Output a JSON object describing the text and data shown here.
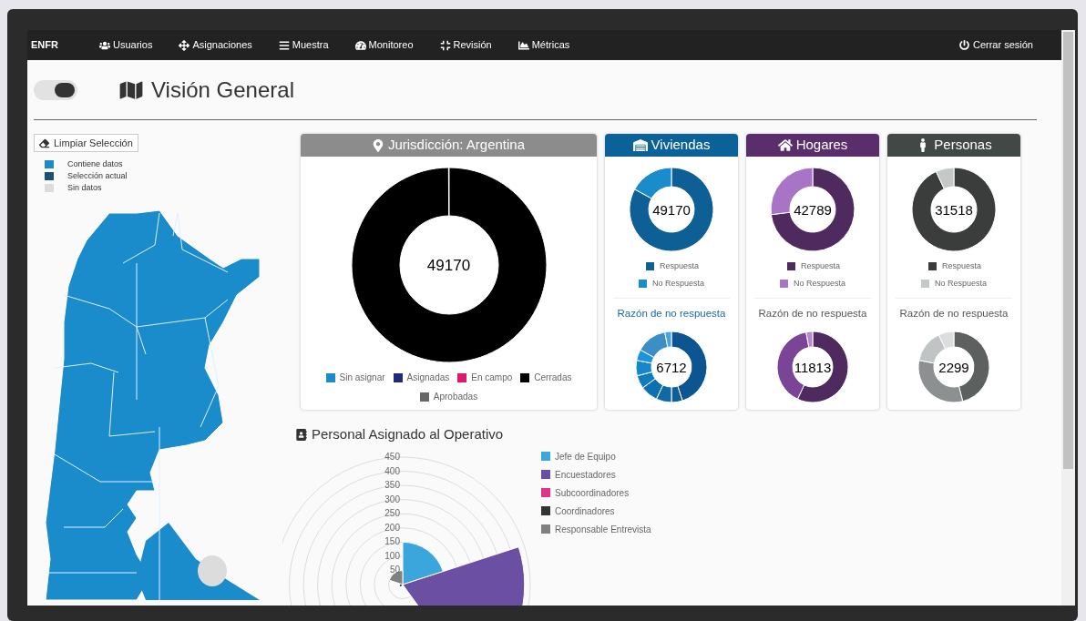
{
  "navbar": {
    "brand": "ENFR",
    "items": [
      {
        "label": "Usuarios"
      },
      {
        "label": "Asignaciones"
      },
      {
        "label": "Muestra"
      },
      {
        "label": "Monitoreo"
      },
      {
        "label": "Revisión"
      },
      {
        "label": "Métricas"
      }
    ],
    "logout": "Cerrar sesión"
  },
  "toggle": {
    "on": true
  },
  "title": "Visión General",
  "map": {
    "clear_button": "Limpiar Selección",
    "legend": [
      {
        "label": "Contiene datos",
        "color": "#1a8ccc"
      },
      {
        "label": "Selección actual",
        "color": "#1d4f7c"
      },
      {
        "label": "Sin datos",
        "color": "#dcdcdc"
      }
    ]
  },
  "jurisdiction": {
    "title": "Jurisdicción: Argentina",
    "center": "49170",
    "legend": [
      {
        "label": "Sin asignar",
        "color": "#1a8ccc"
      },
      {
        "label": "Asignadas",
        "color": "#1f2a7a"
      },
      {
        "label": "En campo",
        "color": "#e0186c"
      },
      {
        "label": "Cerradas",
        "color": "#000000"
      },
      {
        "label": "Aprobadas",
        "color": "#666666"
      }
    ]
  },
  "stat_cards": [
    {
      "title": "Viviendas",
      "color": "#0a6299",
      "center": "49170",
      "legend": [
        {
          "label": "Respuesta",
          "color": "#0d5f96"
        },
        {
          "label": "No Respuesta",
          "color": "#1a8ccc"
        }
      ],
      "reason_title": "Razón de no respuesta",
      "reason_center": "6712"
    },
    {
      "title": "Hogares",
      "color": "#5a2d6b",
      "center": "42789",
      "legend": [
        {
          "label": "Respuesta",
          "color": "#4e2a5e"
        },
        {
          "label": "No Respuesta",
          "color": "#a875c6"
        }
      ],
      "reason_title": "Razón de no respuesta",
      "reason_center": "11813"
    },
    {
      "title": "Personas",
      "color": "#414846",
      "center": "31518",
      "legend": [
        {
          "label": "Respuesta",
          "color": "#3a3d3c"
        },
        {
          "label": "No Respuesta",
          "color": "#c5c8c8"
        }
      ],
      "reason_title": "Razón de no respuesta",
      "reason_center": "2299"
    }
  ],
  "personnel": {
    "title": "Personal Asignado al Operativo",
    "axis_labels": [
      "450",
      "400",
      "350",
      "300",
      "250",
      "200",
      "150",
      "100",
      "50"
    ],
    "legend": [
      {
        "label": "Jefe de Equipo",
        "color": "#3aa6dc"
      },
      {
        "label": "Encuestadores",
        "color": "#6a4fa3"
      },
      {
        "label": "Subcoordinadores",
        "color": "#e0338a"
      },
      {
        "label": "Coordinadores",
        "color": "#333333"
      },
      {
        "label": "Responsable Entrevista",
        "color": "#808080"
      }
    ]
  }
}
